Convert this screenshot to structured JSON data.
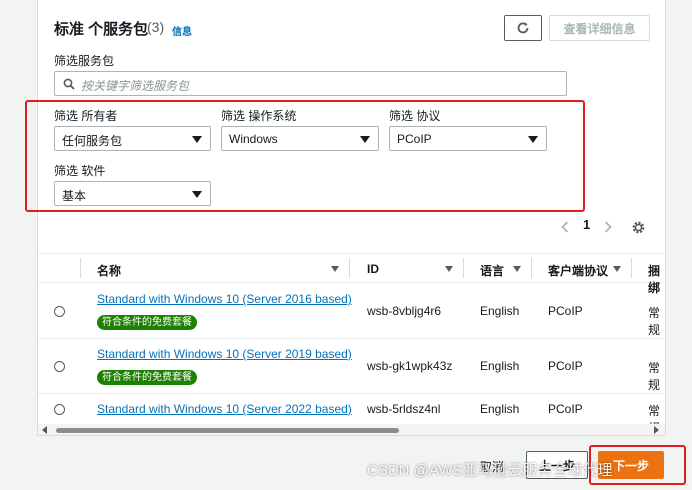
{
  "header": {
    "title": "标准 个服务包",
    "count": "(3)",
    "info_link": "信息",
    "details_button": "查看详细信息"
  },
  "search": {
    "label": "筛选服务包",
    "placeholder": "按关键字筛选服务包"
  },
  "filters": {
    "owner": {
      "label": "筛选 所有者",
      "value": "任何服务包"
    },
    "os": {
      "label": "筛选 操作系统",
      "value": "Windows"
    },
    "protocol": {
      "label": "筛选 协议",
      "value": "PCoIP"
    },
    "software": {
      "label": "筛选 软件",
      "value": "基本"
    }
  },
  "pagination": {
    "page": "1"
  },
  "table": {
    "columns": [
      "名称",
      "ID",
      "语言",
      "客户端协议",
      "捆绑"
    ],
    "rows": [
      {
        "name": "Standard with Windows 10 (Server 2016 based)",
        "badge": "符合条件的免费套餐",
        "id": "wsb-8vbljg4r6",
        "language": "English",
        "protocol": "PCoIP",
        "bundle": "常规"
      },
      {
        "name": "Standard with Windows 10 (Server 2019 based)",
        "badge": "符合条件的免费套餐",
        "id": "wsb-gk1wpk43z",
        "language": "English",
        "protocol": "PCoIP",
        "bundle": "常规"
      },
      {
        "name": "Standard with Windows 10 (Server 2022 based)",
        "badge": "",
        "id": "wsb-5rldsz4nl",
        "language": "English",
        "protocol": "PCoIP",
        "bundle": "常规"
      }
    ]
  },
  "footer": {
    "cancel": "取消",
    "previous": "上一步",
    "next": "下一步"
  },
  "watermark": "CSDN @AWS亚马逊云服务全球代理",
  "colors": {
    "primary": "#ec7211",
    "link": "#0073bb",
    "badge": "#1d8102",
    "highlight": "#e02020"
  }
}
